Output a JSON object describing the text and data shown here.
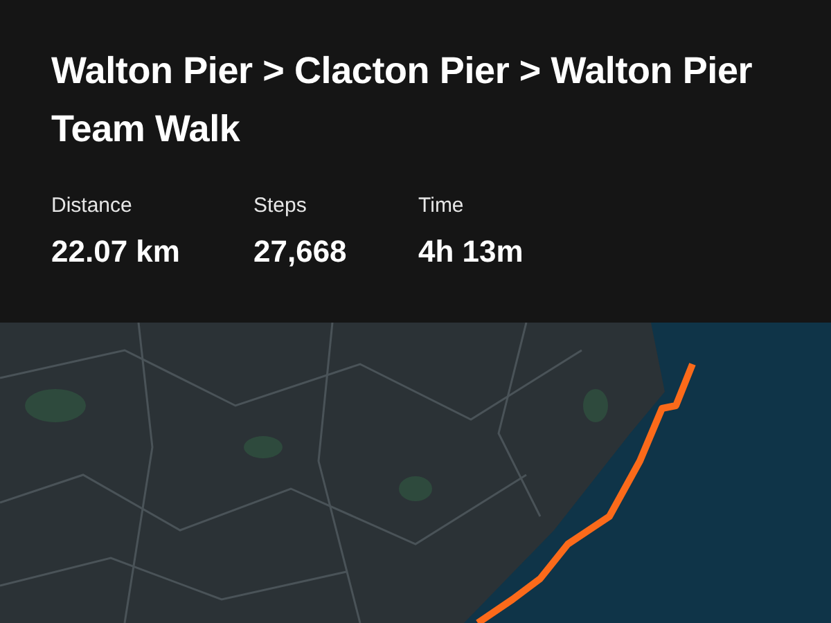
{
  "title": "Walton Pier > Clacton Pier > Walton Pier Team Walk",
  "stats": [
    {
      "label": "Distance",
      "value": "22.07 km"
    },
    {
      "label": "Steps",
      "value": "27,668"
    },
    {
      "label": "Time",
      "value": "4h 13m"
    }
  ]
}
